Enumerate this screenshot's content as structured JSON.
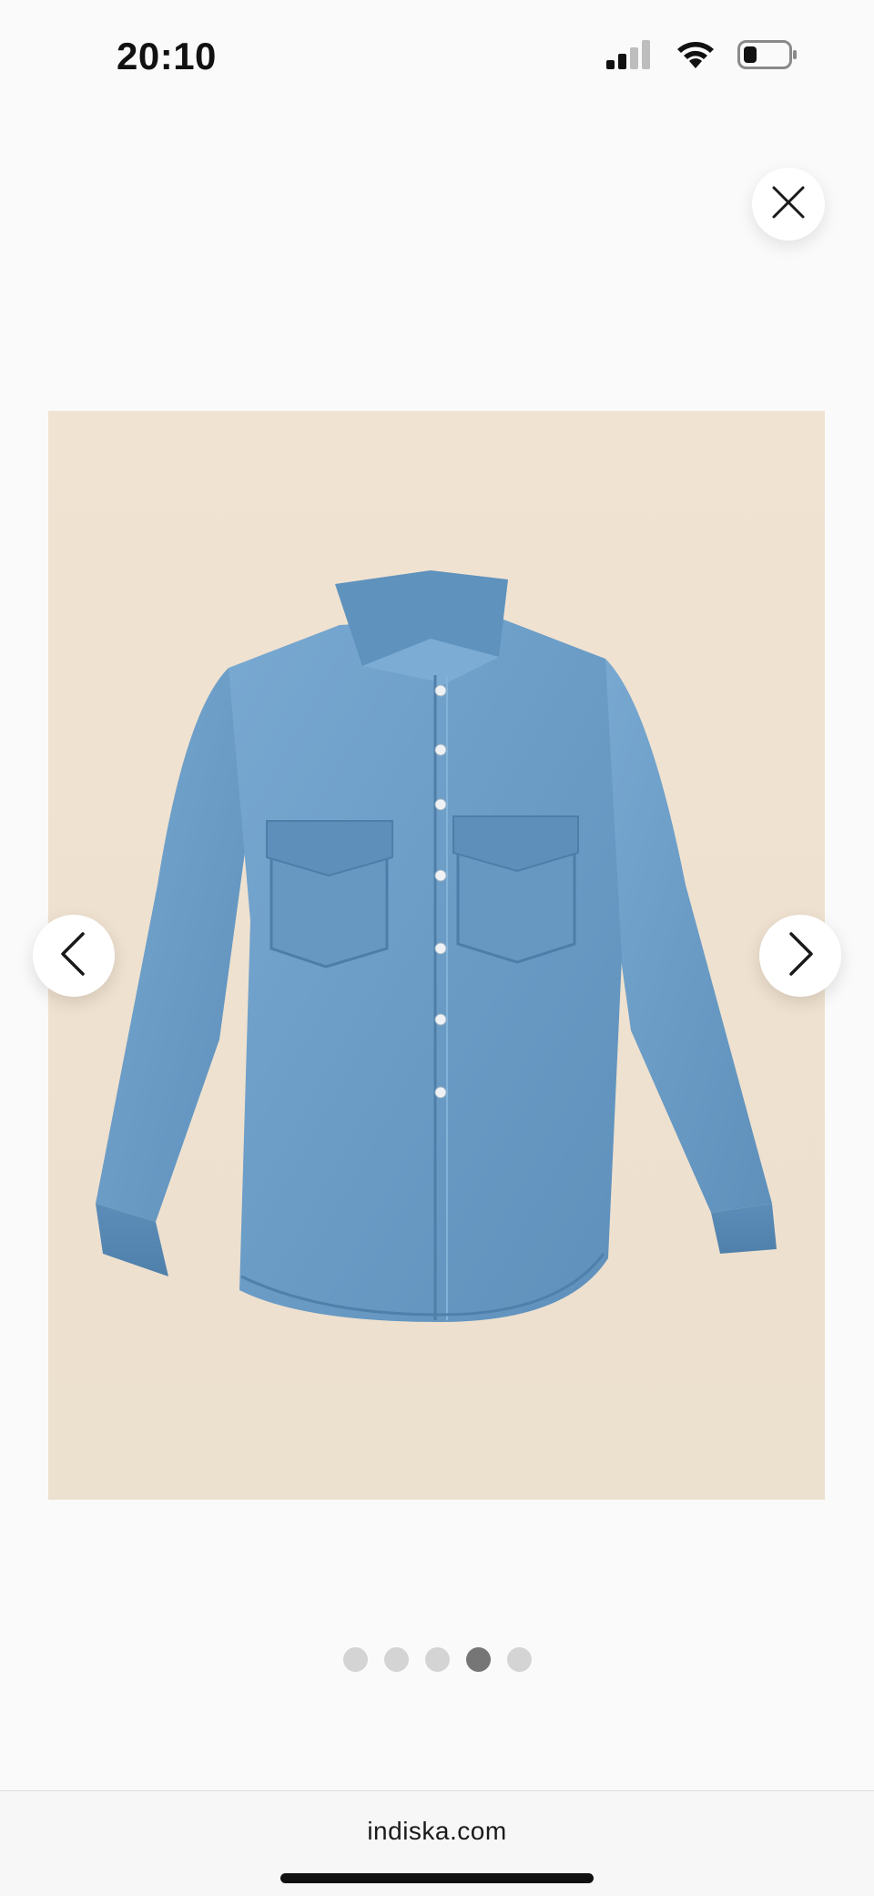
{
  "status_bar": {
    "time": "20:10",
    "signal_icon": "cellular-signal-icon",
    "wifi_icon": "wifi-icon",
    "battery_icon": "battery-low-icon"
  },
  "viewer": {
    "close_icon": "close-icon",
    "prev_icon": "chevron-left-icon",
    "next_icon": "chevron-right-icon",
    "image_subject": "denim shirt",
    "image_background": "#efe1cf",
    "shirt_color": "#6a9cc6",
    "total_images": 5,
    "active_index": 4
  },
  "browser": {
    "url": "indiska.com"
  }
}
